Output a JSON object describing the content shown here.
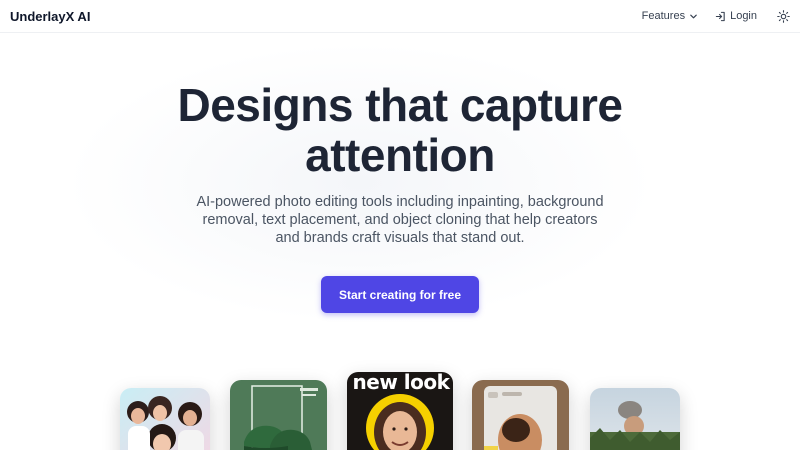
{
  "header": {
    "brand": "UnderlayX AI",
    "nav": {
      "features_label": "Features",
      "login_label": "Login"
    }
  },
  "hero": {
    "title_line1": "Designs that capture",
    "title_line2": "attention",
    "subtitle": "AI-powered photo editing tools including inpainting, background removal, text placement, and object cloning that help creators and brands craft visuals that stand out.",
    "cta_label": "Start creating for free"
  },
  "showcase": {
    "card_3_text": "new look"
  },
  "colors": {
    "accent": "#4f46e5",
    "title": "#1e2535",
    "body_text": "#4b5563"
  },
  "icons": {
    "features_chevron": "chevron-down-icon",
    "login": "log-in-icon",
    "theme": "sun-icon"
  }
}
